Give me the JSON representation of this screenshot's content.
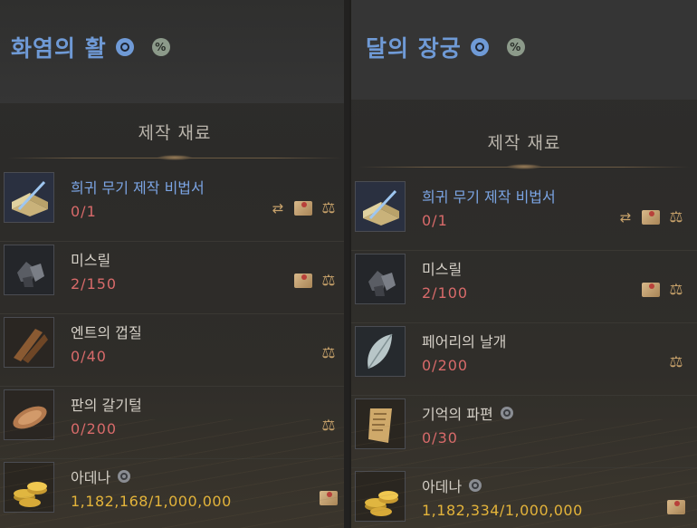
{
  "panels": [
    {
      "title": "화염의 활",
      "section_title": "제작 재료",
      "items": [
        {
          "name": "희귀 무기 제작 비법서",
          "count": "0/1",
          "icon": "recipe-book-icon",
          "rare": true,
          "actions": [
            "exchange",
            "map",
            "scale"
          ]
        },
        {
          "name": "미스릴",
          "count": "2/150",
          "icon": "mithril-ore-icon",
          "rare": false,
          "actions": [
            "map",
            "scale"
          ]
        },
        {
          "name": "엔트의 껍질",
          "count": "0/40",
          "icon": "ent-bark-icon",
          "rare": false,
          "actions": [
            "scale"
          ]
        },
        {
          "name": "판의 갈기털",
          "count": "0/200",
          "icon": "pan-mane-icon",
          "rare": false,
          "actions": [
            "scale"
          ]
        },
        {
          "name": "아데나",
          "count": "1,182,168/1,000,000",
          "icon": "adena-coins-icon",
          "rare": false,
          "badge": true,
          "gold": true,
          "actions": [
            "map"
          ]
        }
      ]
    },
    {
      "title": "달의 장궁",
      "section_title": "제작 재료",
      "items": [
        {
          "name": "희귀 무기 제작 비법서",
          "count": "0/1",
          "icon": "recipe-book-icon",
          "rare": true,
          "actions": [
            "exchange",
            "map",
            "scale"
          ]
        },
        {
          "name": "미스릴",
          "count": "2/100",
          "icon": "mithril-ore-icon",
          "rare": false,
          "actions": [
            "map",
            "scale"
          ]
        },
        {
          "name": "페어리의 날개",
          "count": "0/200",
          "icon": "fairy-wing-icon",
          "rare": false,
          "actions": [
            "scale"
          ]
        },
        {
          "name": "기억의 파편",
          "count": "0/30",
          "icon": "memory-fragment-icon",
          "rare": false,
          "badge": true,
          "actions": []
        },
        {
          "name": "아데나",
          "count": "1,182,334/1,000,000",
          "icon": "adena-coins-icon",
          "rare": false,
          "badge": true,
          "gold": true,
          "actions": [
            "map"
          ]
        }
      ]
    }
  ],
  "colors": {
    "title_blue": "#6f9ad6",
    "count_red": "#d86a6a",
    "count_gold": "#e4b43a",
    "action_tan": "#c9a36b"
  },
  "icons": {
    "bless": "blessing-icon",
    "percent": "percent-icon"
  }
}
